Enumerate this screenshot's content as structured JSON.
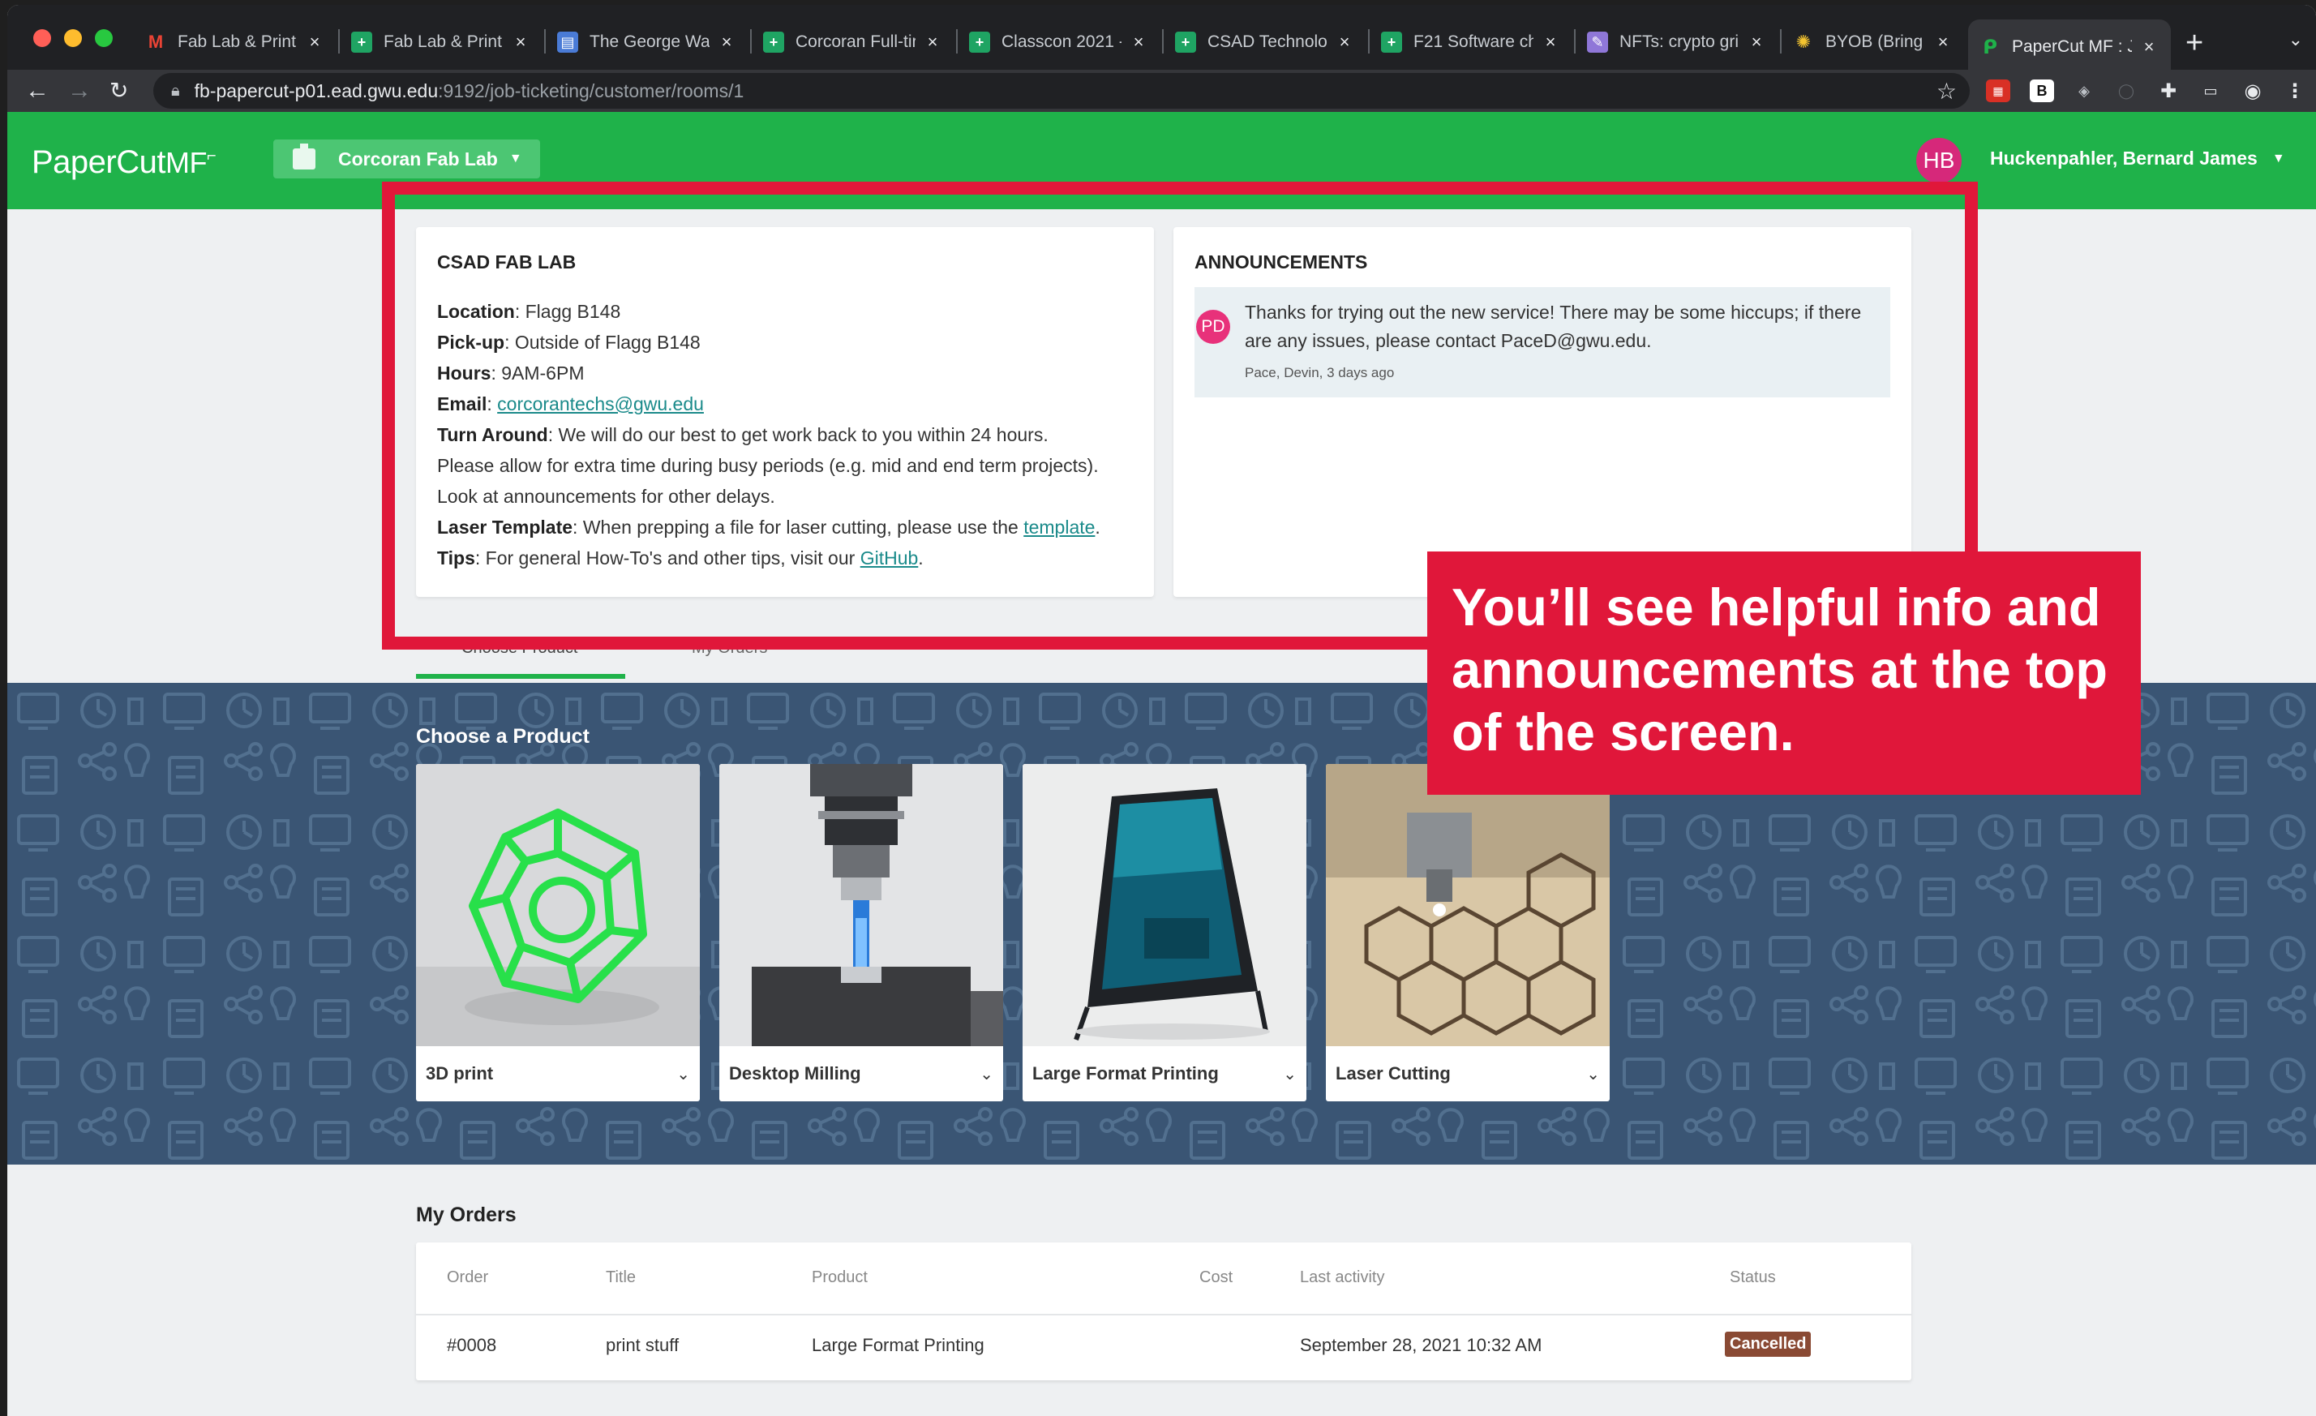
{
  "browser": {
    "tabs": [
      {
        "label": "Fab Lab & Print",
        "icon": "gmail-icon",
        "color": "#ffffff"
      },
      {
        "label": "Fab Lab & Print",
        "icon": "sheets-icon",
        "color": "#1fa463"
      },
      {
        "label": "The George Was",
        "icon": "doc-icon",
        "color": "#4a7bd6"
      },
      {
        "label": "Corcoran Full-tir",
        "icon": "sheets-icon",
        "color": "#1fa463"
      },
      {
        "label": "Classcon 2021 -",
        "icon": "sheets-icon",
        "color": "#1fa463"
      },
      {
        "label": "CSAD Technolog",
        "icon": "sheets-icon",
        "color": "#1fa463"
      },
      {
        "label": "F21 Software ch",
        "icon": "sheets-icon",
        "color": "#1fa463"
      },
      {
        "label": "NFTs: crypto gri",
        "icon": "article-icon",
        "color": "#8f77d8"
      },
      {
        "label": "BYOB (Bring You",
        "icon": "bulb-icon",
        "color": "#f4c430"
      },
      {
        "label": "PaperCut MF : J",
        "icon": "papercut-icon",
        "color": "#1fb24a"
      }
    ],
    "url_host": "fb-papercut-p01.ead.gwu.edu",
    "url_path": ":9192/job-ticketing/customer/rooms/1"
  },
  "app": {
    "logo": "PaperCut",
    "logo_suffix": "MF",
    "room": "Corcoran Fab Lab",
    "user_initials": "HB",
    "user_name": "Huckenpahler, Bernard James"
  },
  "info": {
    "title": "CSAD FAB LAB",
    "location_label": "Location",
    "location": "Flagg B148",
    "pickup_label": "Pick-up",
    "pickup": "Outside of Flagg B148",
    "hours_label": "Hours",
    "hours": "9AM-6PM",
    "email_label": "Email",
    "email": "corcorantechs@gwu.edu",
    "turnaround_label": "Turn Around",
    "turnaround_1": "We will do our best to get work back to you within 24 hours.",
    "turnaround_2": "Please allow for extra time during busy periods (e.g. mid and end term projects).",
    "turnaround_3": "Look at announcements for other delays.",
    "laser_label": "Laser Template",
    "laser_text": "When prepping a file for laser cutting, please use the",
    "laser_link": "template",
    "tips_label": "Tips",
    "tips_text": "For general How-To's and other tips, visit our",
    "tips_link": "GitHub"
  },
  "announcements": {
    "title": "ANNOUNCEMENTS",
    "items": [
      {
        "initials": "PD",
        "text": "Thanks for trying out the new service! There may be some hiccups; if there are any issues, please contact PaceD@gwu.edu.",
        "meta": "Pace, Devin, 3 days ago"
      }
    ]
  },
  "page_tabs": {
    "choose": "Choose Product",
    "orders": "My Orders"
  },
  "products": {
    "title": "Choose a Product",
    "items": [
      {
        "name": "3D print"
      },
      {
        "name": "Desktop Milling"
      },
      {
        "name": "Large Format Printing"
      },
      {
        "name": "Laser Cutting"
      }
    ]
  },
  "callout": {
    "text": "You’ll see helpful info and announcements at the top of the screen."
  },
  "orders": {
    "title": "My Orders",
    "columns": [
      "Order",
      "Title",
      "Product",
      "Cost",
      "Last activity",
      "Status"
    ],
    "rows": [
      {
        "order": "#0008",
        "title": "print stuff",
        "product": "Large Format Printing",
        "cost": "",
        "last_activity": "September 28, 2021 10:32 AM",
        "status": "Cancelled"
      }
    ]
  },
  "colors": {
    "brand_green": "#1fb24a",
    "highlight_red": "#e0173a",
    "band_blue": "#3a5574",
    "status_cancelled": "#8a4a34"
  }
}
